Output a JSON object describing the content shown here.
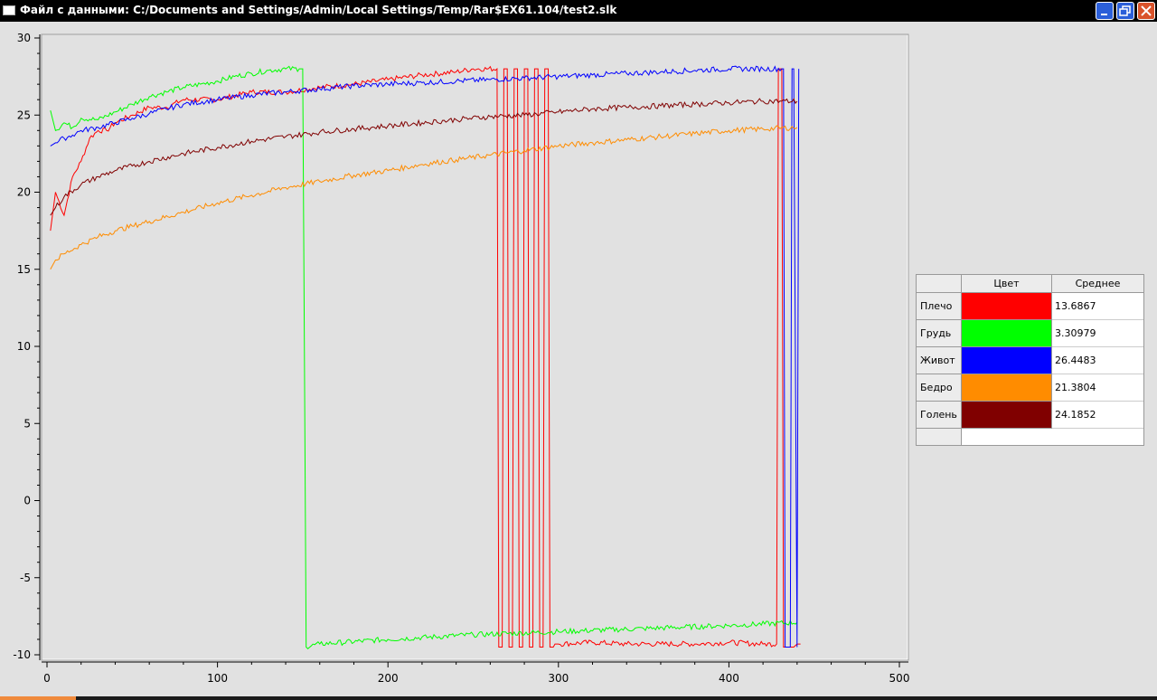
{
  "window": {
    "title": "Файл с данными: C:/Documents and Settings/Admin/Local Settings/Temp/Rar$EX61.104/test2.slk",
    "app_icon": "window-icon",
    "buttons": [
      "minimize-icon",
      "maximize-icon",
      "close-icon"
    ]
  },
  "legend": {
    "columns": [
      "Цвет",
      "Среднее"
    ],
    "rows": [
      {
        "label": "Плечо",
        "color": "#ff0000",
        "mean": "13.6867"
      },
      {
        "label": "Грудь",
        "color": "#00ff00",
        "mean": "3.30979"
      },
      {
        "label": "Живот",
        "color": "#0000ff",
        "mean": "26.4483"
      },
      {
        "label": "Бедро",
        "color": "#ff8c00",
        "mean": "21.3804"
      },
      {
        "label": "Голень",
        "color": "#800000",
        "mean": "24.1852"
      }
    ]
  },
  "chart_data": {
    "type": "line",
    "xlim": [
      0,
      500
    ],
    "ylim": [
      -10,
      30
    ],
    "x_ticks": [
      0,
      100,
      200,
      300,
      400,
      500
    ],
    "y_ticks": [
      -10,
      -5,
      0,
      5,
      10,
      15,
      20,
      25,
      30
    ],
    "x_tick_labels": [
      "0",
      "100",
      "200",
      "300",
      "400",
      "500"
    ],
    "y_tick_labels": [
      "-10",
      "-5",
      "0",
      "5",
      "10",
      "15",
      "20",
      "25",
      "30"
    ],
    "grid": false,
    "series": [
      {
        "name": "Плечо",
        "color": "#ff0000",
        "x": [
          2,
          5,
          10,
          15,
          20,
          25,
          30,
          35,
          40,
          50,
          60,
          70,
          80,
          100,
          120,
          140,
          160,
          180,
          200,
          220,
          240,
          250,
          264,
          265,
          267,
          268,
          270,
          271,
          273,
          274,
          276,
          277,
          279,
          280,
          282,
          283,
          285,
          286,
          288,
          289,
          291,
          292,
          294,
          295,
          297,
          298,
          300,
          320,
          340,
          360,
          380,
          400,
          420,
          428,
          429,
          431,
          432,
          434,
          436,
          438,
          440,
          442
        ],
        "y": [
          17.5,
          20,
          18.5,
          21,
          22,
          23.5,
          24,
          24,
          24.5,
          25,
          25.5,
          25.5,
          26,
          26,
          26.5,
          26.5,
          26.8,
          27,
          27.3,
          27.6,
          27.8,
          28,
          28,
          -9.5,
          -9.5,
          28,
          28,
          -9.5,
          -9.5,
          28,
          28,
          -9.5,
          -9.5,
          28,
          28,
          -9.5,
          -9.5,
          28,
          28,
          -9.5,
          -9.5,
          28,
          28,
          -9.5,
          -9.5,
          -9.3,
          -9.3,
          -9.2,
          -9.3,
          -9.3,
          -9.3,
          -9.2,
          -9.3,
          -9.3,
          28,
          28,
          -9.5,
          -9.5,
          -9.5,
          -9.5,
          -9.3,
          -9.3
        ]
      },
      {
        "name": "Грудь",
        "color": "#00ff00",
        "x": [
          2,
          5,
          10,
          15,
          20,
          30,
          40,
          50,
          60,
          70,
          80,
          90,
          100,
          110,
          120,
          130,
          140,
          148,
          150,
          152,
          160,
          200,
          250,
          300,
          350,
          400,
          440
        ],
        "y": [
          25.3,
          24,
          24.5,
          24.2,
          24.8,
          24.7,
          25.2,
          25.7,
          26.2,
          26.5,
          26.8,
          27,
          27.2,
          27.5,
          27.7,
          27.9,
          28,
          28,
          28,
          -9.5,
          -9.3,
          -9,
          -8.7,
          -8.5,
          -8.3,
          -8.1,
          -7.9
        ]
      },
      {
        "name": "Живот",
        "color": "#0000ff",
        "x": [
          2,
          5,
          10,
          15,
          20,
          30,
          40,
          50,
          60,
          70,
          80,
          100,
          120,
          140,
          160,
          180,
          200,
          220,
          240,
          260,
          280,
          300,
          320,
          340,
          360,
          380,
          400,
          420,
          432,
          433,
          436,
          437,
          438,
          440,
          441
        ],
        "y": [
          23,
          23.2,
          23.5,
          23.7,
          24,
          24.2,
          24.5,
          24.8,
          25.1,
          25.4,
          25.7,
          26,
          26.3,
          26.5,
          26.7,
          26.9,
          27,
          27.1,
          27.2,
          27.3,
          27.4,
          27.5,
          27.6,
          27.7,
          27.8,
          27.9,
          28,
          28,
          28,
          -9.5,
          -9.5,
          28,
          28,
          -9.5,
          28
        ]
      },
      {
        "name": "Бедро",
        "color": "#ff8c00",
        "x": [
          2,
          5,
          10,
          20,
          30,
          40,
          50,
          60,
          80,
          100,
          120,
          140,
          160,
          180,
          200,
          220,
          240,
          260,
          280,
          300,
          320,
          340,
          360,
          380,
          400,
          420,
          440
        ],
        "y": [
          15,
          15.6,
          16,
          16.6,
          17.1,
          17.5,
          17.8,
          18.1,
          18.7,
          19.3,
          19.8,
          20.3,
          20.7,
          21.1,
          21.4,
          21.8,
          22.1,
          22.4,
          22.7,
          23,
          23.2,
          23.4,
          23.6,
          23.8,
          24,
          24.1,
          24.2
        ]
      },
      {
        "name": "Голень",
        "color": "#800000",
        "x": [
          2,
          5,
          10,
          20,
          30,
          40,
          50,
          60,
          80,
          100,
          120,
          140,
          160,
          180,
          200,
          220,
          240,
          260,
          280,
          300,
          320,
          340,
          360,
          380,
          400,
          420,
          440
        ],
        "y": [
          18.5,
          19,
          19.7,
          20.5,
          21,
          21.4,
          21.7,
          22,
          22.5,
          22.9,
          23.3,
          23.6,
          23.9,
          24.1,
          24.3,
          24.5,
          24.7,
          24.9,
          25,
          25.2,
          25.4,
          25.5,
          25.6,
          25.7,
          25.8,
          25.9,
          25.9
        ]
      }
    ]
  }
}
